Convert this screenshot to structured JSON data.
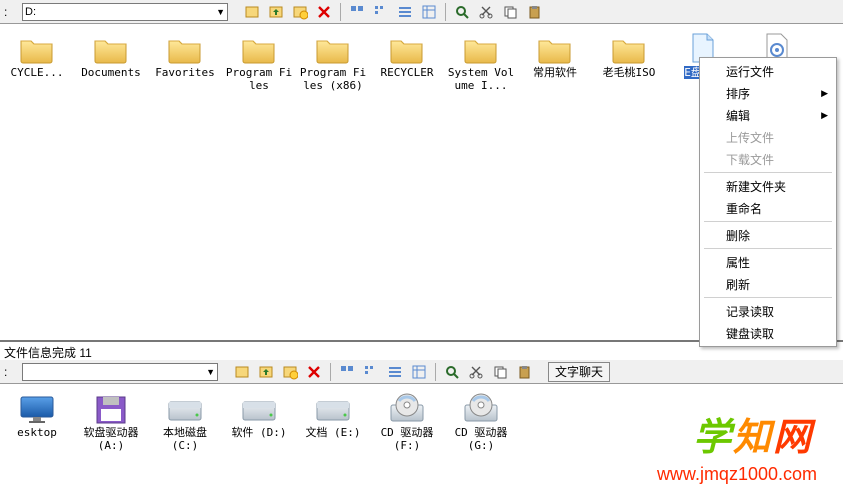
{
  "toolbar_top": {
    "path_value": "D:",
    "buttons": {
      "back": "back",
      "up": "up",
      "newfolder": "new",
      "delete": "delete",
      "v_large": "large",
      "v_small": "small",
      "v_list": "list",
      "v_detail": "detail",
      "search": "search",
      "cut": "cut",
      "copy": "copy",
      "paste": "paste"
    }
  },
  "pane1_items": [
    {
      "label": "CYCLE...",
      "type": "folder"
    },
    {
      "label": "Documents",
      "type": "folder"
    },
    {
      "label": "Favorites",
      "type": "folder"
    },
    {
      "label": "Program Files",
      "type": "folder"
    },
    {
      "label": "Program Files (x86)",
      "type": "folder"
    },
    {
      "label": "RECYCLER",
      "type": "folder"
    },
    {
      "label": "System Volume I...",
      "type": "folder"
    },
    {
      "label": "常用软件",
      "type": "folder"
    },
    {
      "label": "老毛桃ISO",
      "type": "folder"
    },
    {
      "label": "E盘...",
      "type": "file",
      "selected": true
    },
    {
      "label": "",
      "type": "config"
    }
  ],
  "context_menu": [
    {
      "label": "运行文件",
      "enabled": true
    },
    {
      "label": "排序",
      "enabled": true,
      "submenu": true
    },
    {
      "label": "编辑",
      "enabled": true,
      "submenu": true
    },
    {
      "label": "上传文件",
      "enabled": false
    },
    {
      "label": "下载文件",
      "enabled": false
    },
    {
      "sep": true
    },
    {
      "label": "新建文件夹",
      "enabled": true
    },
    {
      "label": "重命名",
      "enabled": true
    },
    {
      "sep": true
    },
    {
      "label": "删除",
      "enabled": true
    },
    {
      "sep": true
    },
    {
      "label": "属性",
      "enabled": true
    },
    {
      "label": "刷新",
      "enabled": true
    },
    {
      "sep": true
    },
    {
      "label": "记录读取",
      "enabled": true
    },
    {
      "label": "键盘读取",
      "enabled": true
    }
  ],
  "status_text": "文件信息完成  11",
  "toolbar_bottom": {
    "path_value": "",
    "textchat_label": "文字聊天"
  },
  "pane2_items": [
    {
      "label": "esktop",
      "type": "desktop"
    },
    {
      "label": "软盘驱动器 (A:)",
      "type": "floppy"
    },
    {
      "label": "本地磁盘 (C:)",
      "type": "hdd"
    },
    {
      "label": "软件 (D:)",
      "type": "hdd"
    },
    {
      "label": "文档 (E:)",
      "type": "hdd"
    },
    {
      "label": "CD 驱动器 (F:)",
      "type": "cd"
    },
    {
      "label": "CD 驱动器 (G:)",
      "type": "cd"
    }
  ],
  "watermark": {
    "brand": "学知网",
    "url": "www.jmqz1000.com"
  }
}
